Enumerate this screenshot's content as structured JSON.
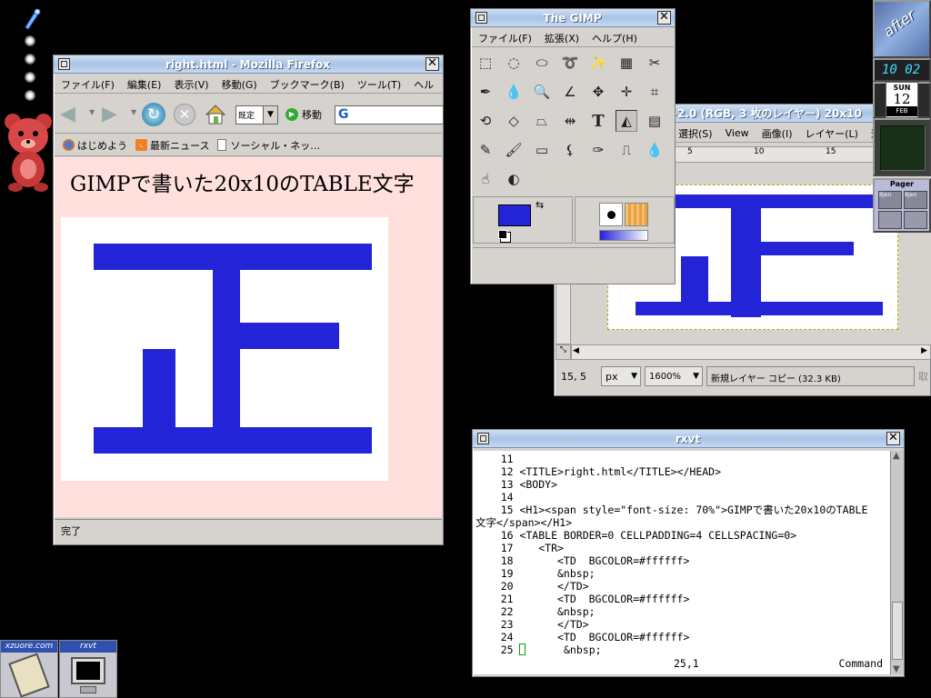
{
  "dock": {
    "icons": [
      "pen-icon"
    ],
    "bear": "bear-mascot"
  },
  "firefox": {
    "title": "right.html - Mozilla Firefox",
    "menu": [
      "ファイル(F)",
      "編集(E)",
      "表示(V)",
      "移動(G)",
      "ブックマーク(B)",
      "ツール(T)",
      "ヘル"
    ],
    "encoding": "既定",
    "go_label": "移動",
    "search_letter": "G",
    "bookmarks": [
      "はじめよう",
      "最新ニュース",
      "ソーシャル・ネッ…"
    ],
    "heading": "GIMPで書いた20x10のTABLE文字",
    "glyph": "正",
    "status": "完了",
    "colors": {
      "page_bg": "#ffe0dc",
      "glyph": "#2323d8"
    }
  },
  "gimp_toolbox": {
    "title": "The GIMP",
    "menu": [
      "ファイル(F)",
      "拡張(X)",
      "ヘルプ(H)"
    ],
    "tools": [
      "rect-select-icon",
      "ellipse-select-icon",
      "free-select-icon",
      "lasso-icon",
      "fuzzy-select-icon",
      "color-select-icon",
      "scissors-icon",
      "paths-icon",
      "color-picker-icon",
      "zoom-icon",
      "measure-icon",
      "move-icon",
      "move-arrows-icon",
      "crop-icon",
      "transform-icon",
      "rotate-icon",
      "perspective-icon",
      "flip-icon",
      "text-icon",
      "bucket-fill-icon",
      "blend-icon",
      "pencil-icon",
      "paintbrush-icon",
      "eraser-icon",
      "airbrush-icon",
      "ink-icon",
      "clone-icon",
      "blur-icon",
      "smudge-icon",
      "dodge-burn-icon"
    ],
    "fg_color": "#2323d8",
    "bg_color": "#ffffff"
  },
  "gimp_image": {
    "title_fragment": "-2.0 (RGB, 3 枚のレイヤー) 20x10",
    "menu": [
      "選択(S)",
      "View",
      "画像(I)",
      "レイヤー(L)",
      "道"
    ],
    "ruler_marks": [
      "5",
      "10",
      "15"
    ],
    "coords": "15, 5",
    "unit": "px",
    "zoom": "1600%",
    "status": "新規レイヤー コピー (32.3 KB)",
    "cancel": "取"
  },
  "dockapps": {
    "logo": "after",
    "time": "10 02",
    "day": "SUN",
    "date": "12",
    "month": "FEB",
    "pager_title": "Pager",
    "pager_labels": [
      "Bjen",
      "Bjen"
    ]
  },
  "rxvt": {
    "title": "rxvt",
    "lines": [
      "    11",
      "    12 <TITLE>right.html</TITLE></HEAD>",
      "    13 <BODY>",
      "    14",
      "    15 <H1><span style=\"font-size: 70%\">GIMPで書いた20x10のTABLE",
      "文字</span></H1>",
      "    16 <TABLE BORDER=0 CELLPADDING=4 CELLSPACING=0>",
      "    17    <TR>",
      "    18       <TD  BGCOLOR=#ffffff>",
      "    19       &nbsp;",
      "    20       </TD>",
      "    21       <TD  BGCOLOR=#ffffff>",
      "    22       &nbsp;",
      "    23       </TD>",
      "    24       <TD  BGCOLOR=#ffffff>",
      "    25 "
    ],
    "line25_rest": "      &nbsp;",
    "position": "25,1",
    "mode": "Command"
  },
  "taskbar": {
    "items": [
      "xzuore.com",
      "rxvt"
    ]
  }
}
